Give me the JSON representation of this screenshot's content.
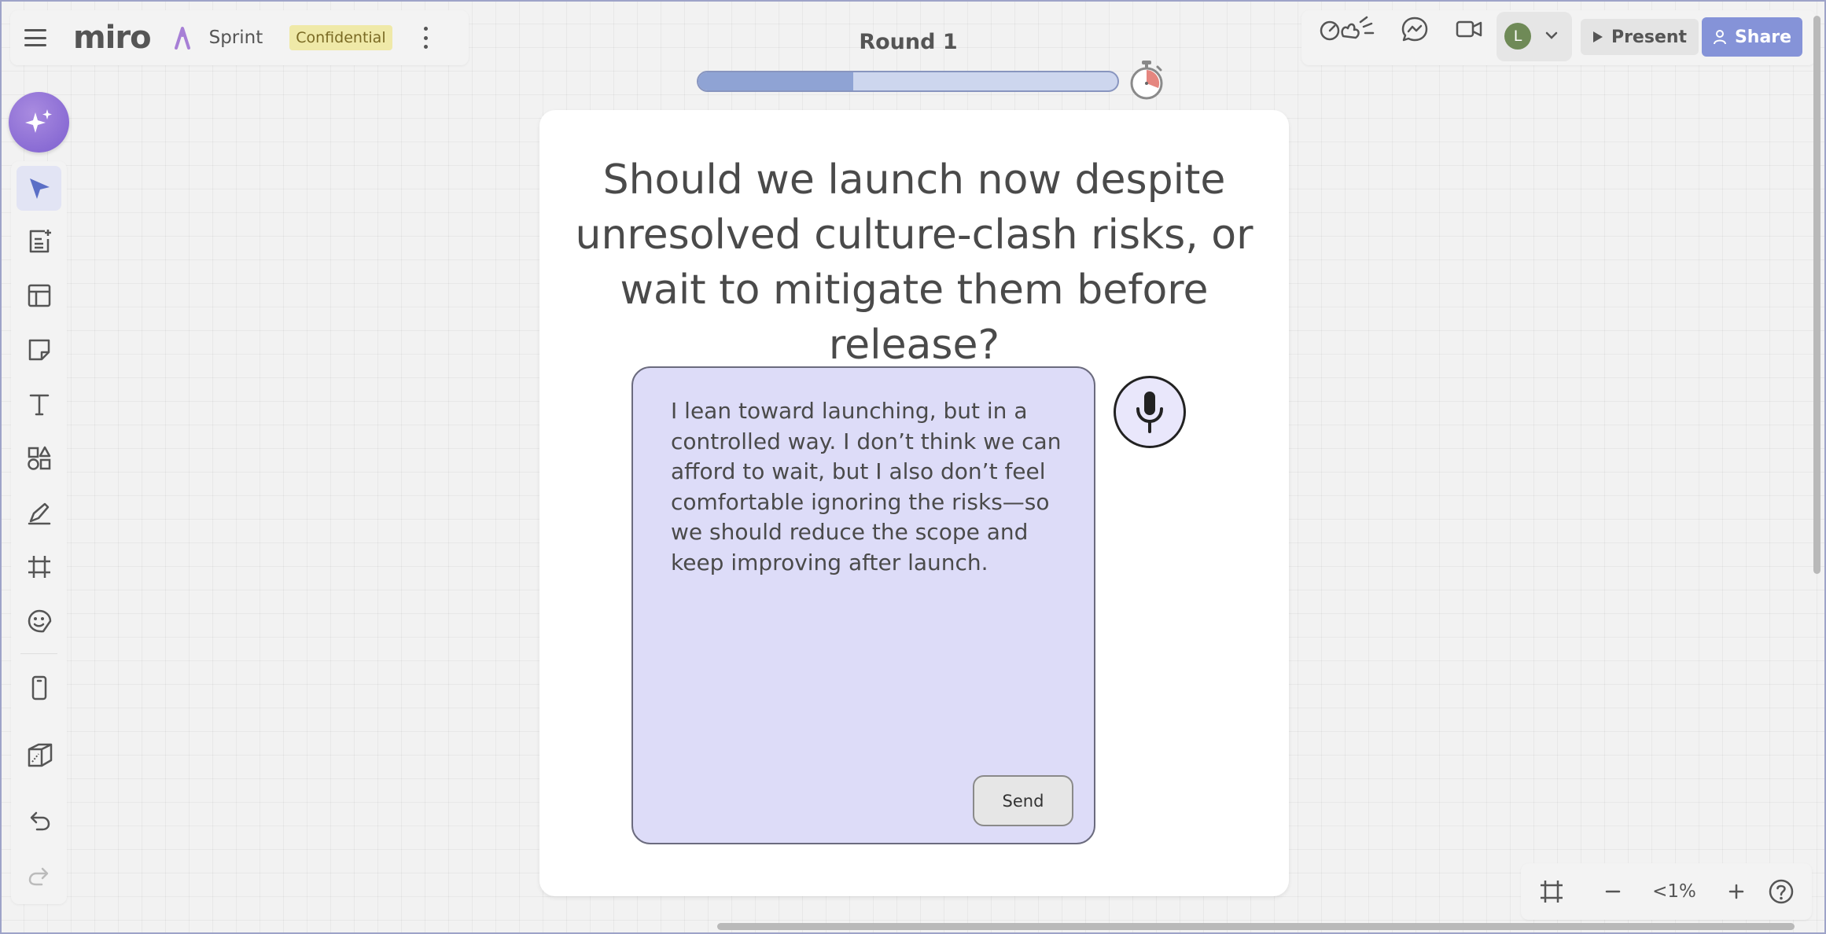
{
  "app": {
    "logo": "miro",
    "board_name": "Sprint",
    "badge": "Confidential"
  },
  "round": {
    "title": "Round 1",
    "progress": 0.37
  },
  "toolbar": {
    "present_label": "Present",
    "share_label": "Share",
    "avatar_initial": "L"
  },
  "question": "Should we launch now despite unresolved culture-clash risks, or wait to mitigate them before release?",
  "answer": {
    "text": "I lean toward launching, but in a controlled way. I don’t think we can afford to wait, but I also don’t feel comfortable ignoring the risks—so we should reduce the scope and keep improving after launch.",
    "send_label": "Send"
  },
  "zoom": {
    "level": "<1%"
  },
  "colors": {
    "accent": "#8593d8",
    "ai_button": "#7d5fcf",
    "answer_bg": "#dddcf8",
    "progress_fill": "#8fa3d4",
    "badge_bg": "#efe9a8"
  },
  "left_tools": [
    "select-tool",
    "templates-tool",
    "layout-tool",
    "sticky-note-tool",
    "text-tool",
    "shapes-tool",
    "pen-tool",
    "frame-tool",
    "stickers-tool",
    "phone-frame-tool",
    "3d-tool",
    "undo",
    "redo"
  ]
}
